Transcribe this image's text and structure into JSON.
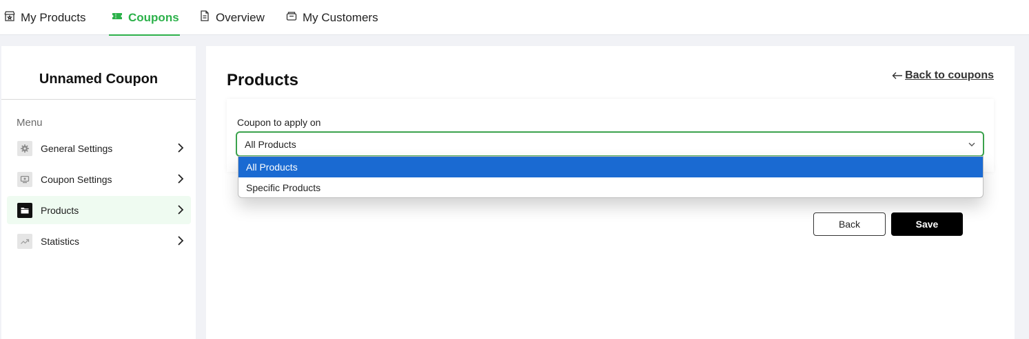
{
  "topnav": {
    "tabs": [
      {
        "label": "My Products",
        "icon": "store-icon"
      },
      {
        "label": "Coupons",
        "icon": "ticket-icon",
        "active": true
      },
      {
        "label": "Overview",
        "icon": "document-icon"
      },
      {
        "label": "My Customers",
        "icon": "customers-icon"
      }
    ]
  },
  "sidebar": {
    "title": "Unnamed Coupon",
    "menu_label": "Menu",
    "items": [
      {
        "label": "General Settings",
        "icon": "gear-icon"
      },
      {
        "label": "Coupon Settings",
        "icon": "coupon-settings-icon"
      },
      {
        "label": "Products",
        "icon": "folder-icon",
        "active": true
      },
      {
        "label": "Statistics",
        "icon": "trend-icon"
      }
    ]
  },
  "main": {
    "title": "Products",
    "back_link": "Back to coupons",
    "field_label": "Coupon to apply on",
    "select_value": "All Products",
    "options": [
      "All Products",
      "Specific Products"
    ],
    "back_button": "Back",
    "save_button": "Save"
  },
  "colors": {
    "accent": "#2cb14a",
    "option_highlight": "#1a6ad2",
    "save_button": "#000000"
  }
}
